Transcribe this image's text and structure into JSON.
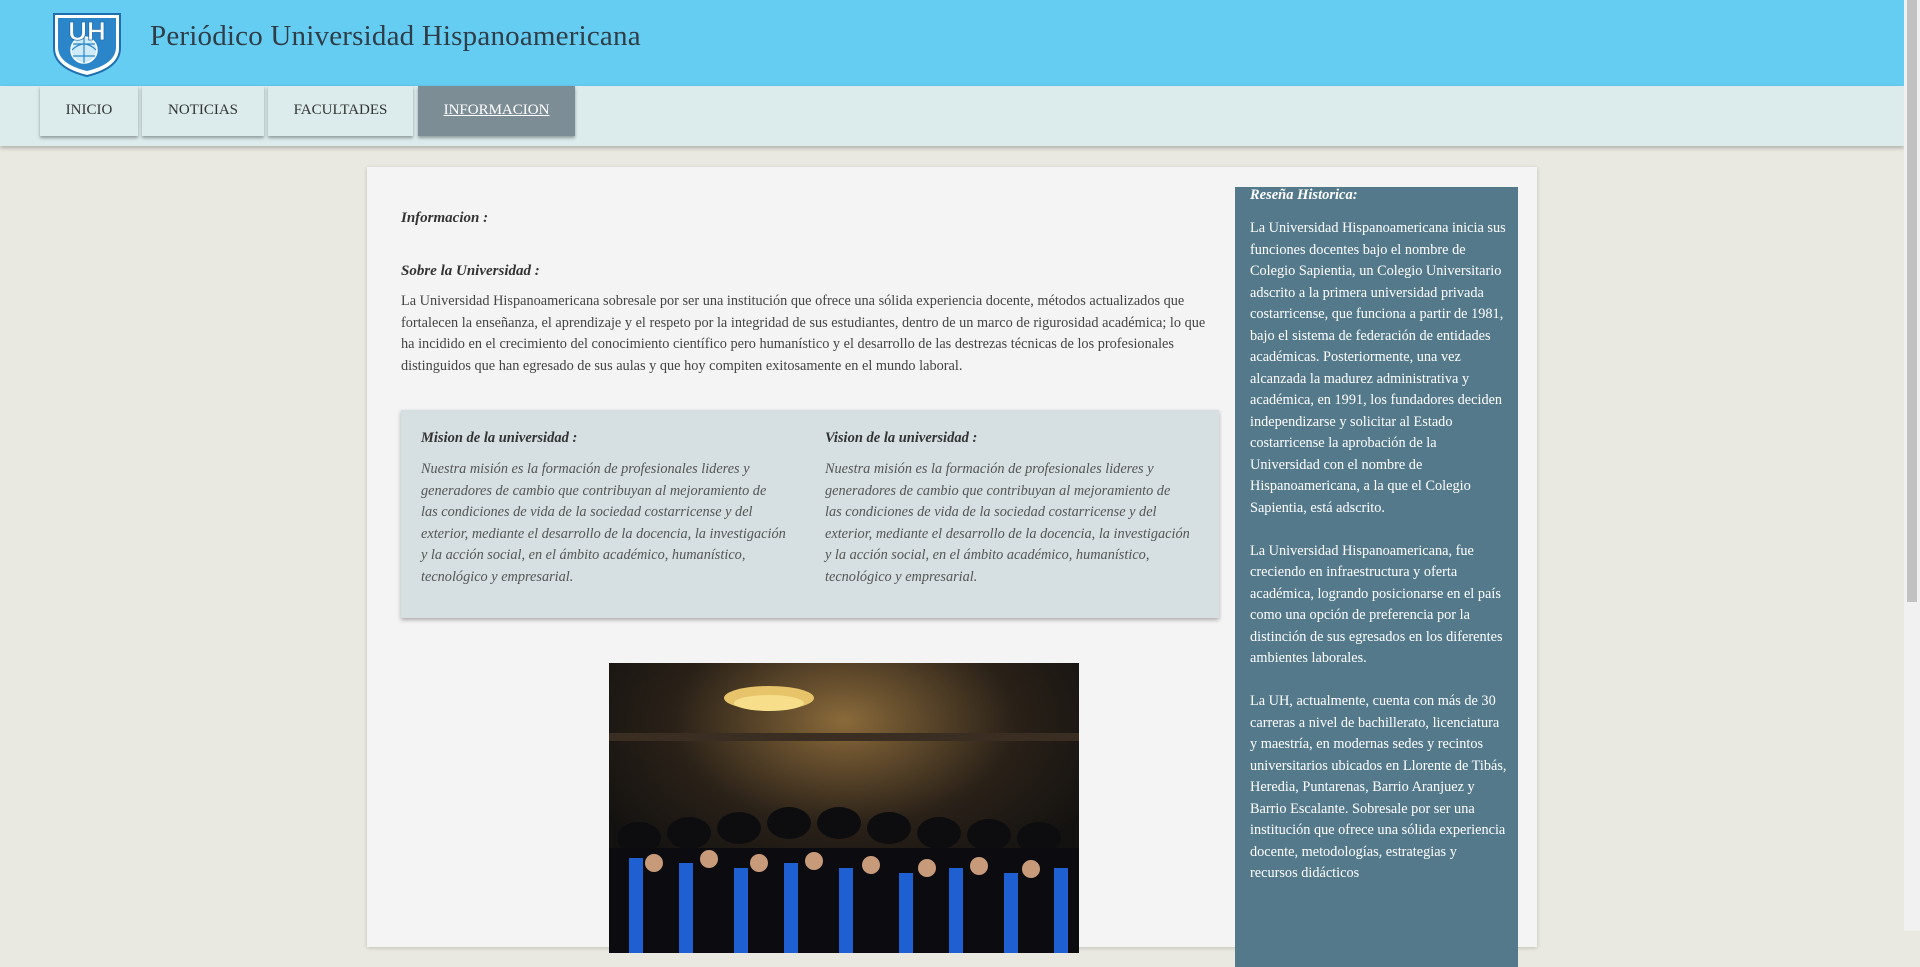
{
  "header": {
    "site_title": "Periódico Universidad Hispanoamericana",
    "logo_text": "UH"
  },
  "nav": {
    "items": [
      {
        "label": "INICIO"
      },
      {
        "label": "NOTICIAS"
      },
      {
        "label": "FACULTADES"
      },
      {
        "label": "INFORMACION",
        "active": true
      }
    ]
  },
  "main": {
    "info_heading": "Informacion :",
    "about_heading": "Sobre la Universidad :",
    "about_text": "La Universidad Hispanoamericana sobresale por ser una institución que ofrece una sólida experiencia docente, métodos actualizados que fortalecen la enseñanza, el aprendizaje y el respeto por la integridad de sus estudiantes, dentro de un marco de rigurosidad académica; lo que ha incidido en el crecimiento del conocimiento científico pero humanístico y el desarrollo de las destrezas técnicas de los profesionales distinguidos que han egresado de sus aulas y que hoy compiten exitosamente en el mundo laboral.",
    "mission": {
      "heading": "Mision de la universidad :",
      "text": "Nuestra misión es la formación de profesionales lideres y generadores de cambio que contribuyan al mejoramiento de las condiciones de vida de la sociedad costarricense y del exterior, mediante el desarrollo de la docencia, la investigación y la acción social, en el ámbito académico, humanístico, tecnológico y empresarial."
    },
    "vision": {
      "heading": "Vision de la universidad :",
      "text": "Nuestra misión es la formación de profesionales lideres y generadores de cambio que contribuyan al mejoramiento de las condiciones de vida de la sociedad costarricense y del exterior, mediante el desarrollo de la docencia, la investigación y la acción social, en el ámbito académico, humanístico, tecnológico y empresarial."
    }
  },
  "sidebar": {
    "title": "Reseña Historica:",
    "paragraphs": [
      "La Universidad Hispanoamericana inicia sus funciones docentes bajo el nombre de Colegio Sapientia, un Colegio Universitario adscrito a la primera universidad privada costarricense, que funciona a partir de 1981, bajo el sistema de federación de entidades académicas. Posteriormente, una vez alcanzada la madurez administrativa y académica, en 1991, los fundadores deciden independizarse y solicitar al Estado costarricense la aprobación de la Universidad con el nombre de Hispanoamericana, a la que el Colegio Sapientia, está adscrito.",
      "La Universidad Hispanoamericana, fue creciendo en infraestructura y oferta académica, logrando posicionarse en el país como una opción de preferencia por la distinción de sus egresados en los diferentes ambientes laborales.",
      "La UH, actualmente, cuenta con más de 30 carreras a nivel de bachillerato, licenciatura y maestría, en modernas sedes y recintos universitarios ubicados en Llorente de Tibás, Heredia, Puntarenas, Barrio Aranjuez y Barrio Escalante. Sobresale por ser una institución que ofrece una sólida experiencia docente, metodologías, estrategias y recursos didácticos"
    ]
  },
  "colors": {
    "header_bg": "#66cdf2",
    "nav_bg": "#dcebec",
    "nav_active_bg": "#7d8d95",
    "sidebar_bg": "#53798b",
    "page_bg": "#e9e9e1"
  }
}
